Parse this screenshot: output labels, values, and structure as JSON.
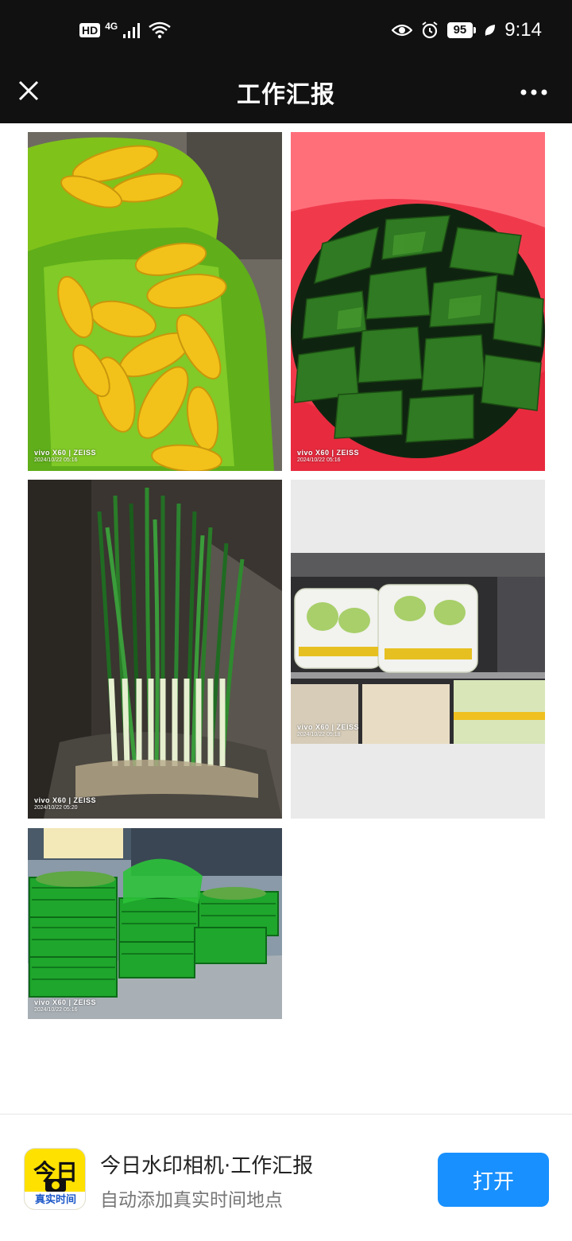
{
  "status_bar": {
    "hd": "HD",
    "network": "4G",
    "battery": "95",
    "time": "9:14",
    "icons": [
      "signal-icon",
      "wifi-icon",
      "eye-icon",
      "alarm-icon",
      "battery-icon",
      "leaf-icon"
    ]
  },
  "nav": {
    "title": "工作汇报",
    "close_icon": "close-icon",
    "more_icon": "more-icon"
  },
  "photos": [
    {
      "subject": "corn",
      "brand": "vivo X60 | ZEISS",
      "date": "2024/10/22 05:16"
    },
    {
      "subject": "kelp",
      "brand": "vivo X60 | ZEISS",
      "date": "2024/10/22 05:16"
    },
    {
      "subject": "green-onion",
      "brand": "vivo X60 | ZEISS",
      "date": "2024/10/22 05:20"
    },
    {
      "subject": "cabbage",
      "brand": "vivo X60 | ZEISS",
      "date": "2024/10/22 05:18"
    },
    {
      "subject": "vegetable-baskets",
      "brand": "vivo X60 | ZEISS",
      "date": "2024/10/22 05:16"
    }
  ],
  "footer": {
    "app_icon_top": "今日",
    "app_icon_bottom": "真实时间",
    "app_name": "今日水印相机·工作汇报",
    "app_subtitle": "自动添加真实时间地点",
    "open_label": "打开"
  },
  "colors": {
    "header_bg": "#111111",
    "open_button": "#1890ff",
    "app_icon_bg": "#ffe100"
  }
}
